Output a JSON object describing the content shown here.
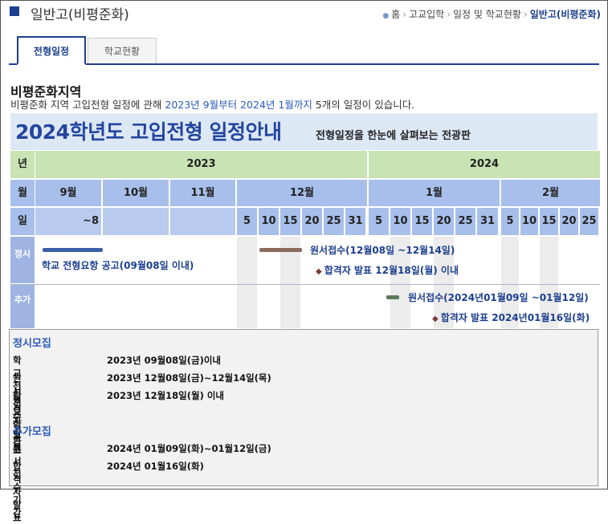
{
  "header": {
    "title": "일반고(비평준화)",
    "breadcrumb": [
      "홈",
      "고교입학",
      "일정 및 학교현황",
      "일반고(비평준화)"
    ]
  },
  "tabs": [
    {
      "label": "전형일정",
      "active": true
    },
    {
      "label": "학교현황",
      "active": false
    }
  ],
  "section": {
    "title": "비평준화지역",
    "intro_pre": "비평준화 지역 고입전형 일정에 관해 ",
    "intro_range": "2023년 9월부터 2024년 1월까지",
    "intro_post": " 5개의 일정이 있습니다."
  },
  "banner": {
    "title": "2024학년도 고입전형 일정안내",
    "subtitle": "전형일정을 한눈에 살펴보는 전광판"
  },
  "calendar": {
    "row_labels": {
      "year": "년",
      "month": "월",
      "day": "일"
    },
    "years": [
      "2023",
      "2024"
    ],
    "months": [
      "9월",
      "10월",
      "11월",
      "12월",
      "1월",
      "2월"
    ],
    "sep_day": "~8",
    "dec_days": [
      "5",
      "10",
      "15",
      "20",
      "25",
      "31"
    ],
    "jan_days": [
      "5",
      "10",
      "15",
      "20",
      "25",
      "31"
    ],
    "feb_days": [
      "5",
      "10",
      "15",
      "20",
      "25"
    ],
    "section_labels": {
      "regular": "정시",
      "additional": "추가"
    },
    "events": {
      "e1": "학교 전형요항 공고(09월08일 이내)",
      "e2": "원서접수(12월08일 ~12월14일)",
      "e3": "합격자 발표 12월18일(월) 이내",
      "e4": "원서접수(2024년01월09일 ~01월12일)",
      "e5": "합격자 발표 2024년01월16일(화)"
    },
    "colors": {
      "year": "#c8e3b4",
      "month": "#a7bfea",
      "label": "#7a99d8"
    }
  },
  "info": {
    "regular": {
      "title": "정시모집",
      "rows": [
        {
          "k": "학교 전형요항 공고",
          "v": "2023년 09월08일(금)이내"
        },
        {
          "k": "원서접수기간",
          "v": "2023년 12월08일(금)~12월14일(목)"
        },
        {
          "k": "합격자발표",
          "v": "2023년 12월18일(월) 이내"
        }
      ]
    },
    "additional": {
      "title": "추가모집",
      "rows": [
        {
          "k": "원서접수기간",
          "v": "2024년 01월09일(화)~01월12일(금)"
        },
        {
          "k": "합격자발표",
          "v": "2024년 01월16일(화)"
        }
      ]
    }
  }
}
